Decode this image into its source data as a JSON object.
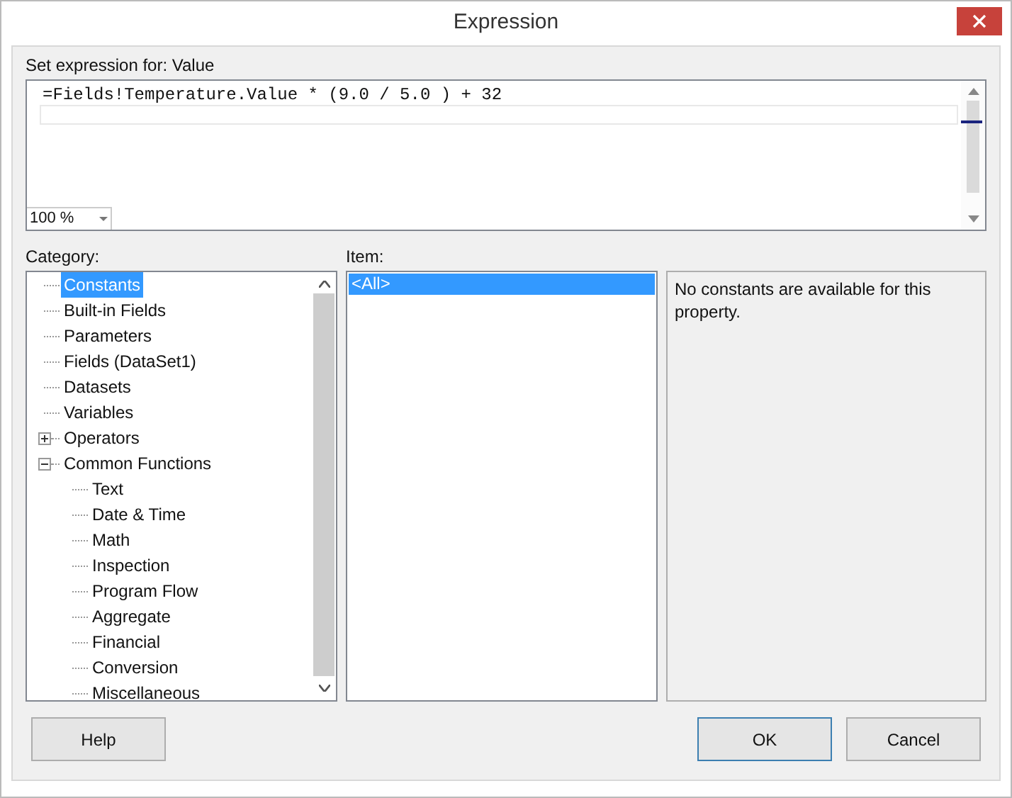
{
  "window": {
    "title": "Expression"
  },
  "expression": {
    "label": "Set expression for: Value",
    "value": "=Fields!Temperature.Value * (9.0 / 5.0 ) + 32",
    "zoom": "100 %"
  },
  "category": {
    "label": "Category:",
    "items": [
      {
        "label": "Constants",
        "selected": true
      },
      {
        "label": "Built-in Fields",
        "selected": false
      },
      {
        "label": "Parameters",
        "selected": false
      },
      {
        "label": "Fields (DataSet1)",
        "selected": false
      },
      {
        "label": "Datasets",
        "selected": false
      },
      {
        "label": "Variables",
        "selected": false
      },
      {
        "label": "Operators",
        "selected": false,
        "expanded": false
      },
      {
        "label": "Common Functions",
        "selected": false,
        "expanded": true,
        "children": [
          {
            "label": "Text",
            "selected": false
          },
          {
            "label": "Date & Time",
            "selected": false
          },
          {
            "label": "Math",
            "selected": false
          },
          {
            "label": "Inspection",
            "selected": false
          },
          {
            "label": "Program Flow",
            "selected": false
          },
          {
            "label": "Aggregate",
            "selected": false
          },
          {
            "label": "Financial",
            "selected": false
          },
          {
            "label": "Conversion",
            "selected": false
          },
          {
            "label": "Miscellaneous",
            "selected": false
          }
        ]
      }
    ]
  },
  "item": {
    "label": "Item:",
    "items": [
      {
        "label": "<All>",
        "selected": true
      }
    ]
  },
  "description": "No constants are available for this property.",
  "buttons": [
    {
      "label": "Help",
      "kind": "plain"
    },
    {
      "label": "OK",
      "kind": "default"
    },
    {
      "label": "Cancel",
      "kind": "plain"
    }
  ]
}
